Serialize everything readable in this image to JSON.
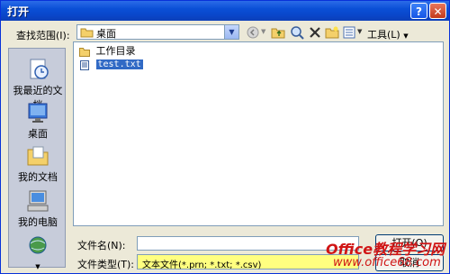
{
  "window": {
    "title": "打开"
  },
  "title_buttons": {
    "help": "?",
    "close": "✕"
  },
  "lookin": {
    "label": "查找范围(I):",
    "value": "桌面"
  },
  "toolbar": {
    "tools_label": "工具(L)"
  },
  "places": [
    {
      "label": "我最近的文档",
      "icon": "recent-documents-icon"
    },
    {
      "label": "桌面",
      "icon": "desktop-icon"
    },
    {
      "label": "我的文档",
      "icon": "my-documents-icon"
    },
    {
      "label": "我的电脑",
      "icon": "my-computer-icon"
    },
    {
      "label": "",
      "icon": "network-places-icon"
    }
  ],
  "files": [
    {
      "name": "工作目录",
      "type": "folder",
      "selected": false
    },
    {
      "name": "test.txt",
      "type": "text-file",
      "selected": true
    }
  ],
  "form": {
    "filename_label": "文件名(N):",
    "filename_value": "",
    "filetype_label": "文件类型(T):",
    "filetype_value": "文本文件(*.prn; *.txt; *.csv)"
  },
  "buttons": {
    "open": "打开(O)",
    "cancel": "取消"
  },
  "watermark": {
    "line1": "Office教程学习网",
    "line2": "www.office68.com"
  },
  "colors": {
    "titlebar": "#0a4fd6",
    "selection": "#316ac5",
    "filetype_highlight": "#ffff80",
    "watermark": "#d01515"
  }
}
